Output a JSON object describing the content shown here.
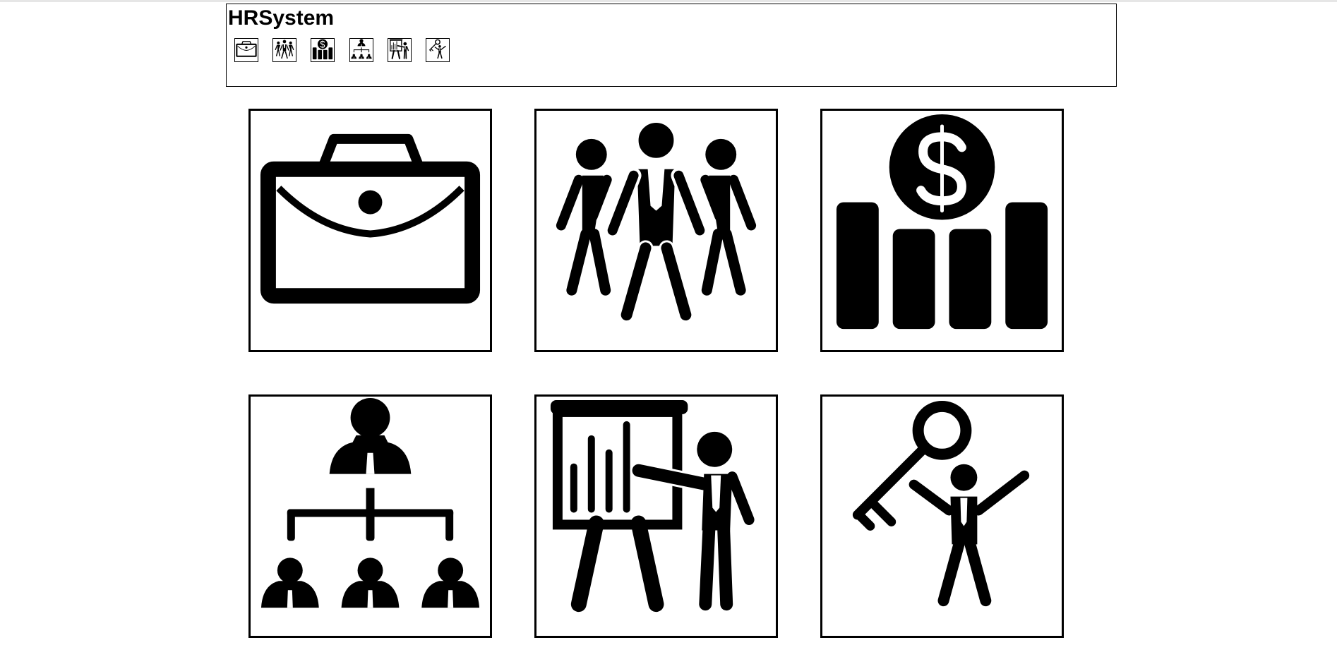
{
  "app": {
    "title": "HRSystem"
  },
  "nav": {
    "items": [
      {
        "icon": "briefcase-icon"
      },
      {
        "icon": "team-icon"
      },
      {
        "icon": "payroll-icon"
      },
      {
        "icon": "org-chart-icon"
      },
      {
        "icon": "presentation-icon"
      },
      {
        "icon": "key-person-icon"
      }
    ]
  },
  "tiles": [
    {
      "icon": "briefcase-icon"
    },
    {
      "icon": "team-icon"
    },
    {
      "icon": "payroll-icon"
    },
    {
      "icon": "org-chart-icon"
    },
    {
      "icon": "presentation-icon"
    },
    {
      "icon": "key-person-icon"
    }
  ],
  "colors": {
    "foreground": "#000000",
    "background": "#ffffff",
    "topline": "#e6e6e6"
  }
}
